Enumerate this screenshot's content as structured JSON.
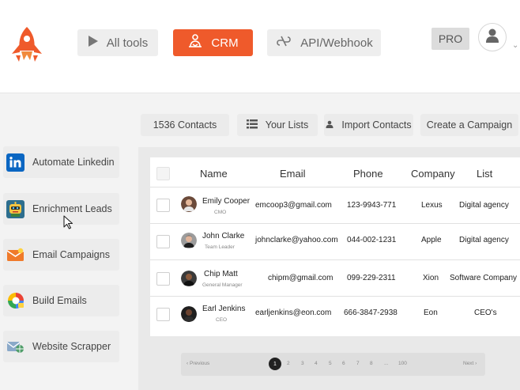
{
  "header": {
    "nav": [
      {
        "label": "All tools",
        "icon": "play-triangle-icon"
      },
      {
        "label": "CRM",
        "icon": "user-lotus-icon"
      },
      {
        "label": "API/Webhook",
        "icon": "webhook-icon"
      }
    ],
    "plan_badge": "PRO",
    "accent_color": "#ef5a2b"
  },
  "toolbar": {
    "contacts_count": "1536 Contacts",
    "your_lists": "Your Lists",
    "import_contacts": "Import Contacts",
    "create_campaign": "Create a Campaign"
  },
  "sidebar": {
    "items": [
      {
        "label": "Automate Linkedin",
        "icon": "linkedin-icon"
      },
      {
        "label": "Enrichment Leads",
        "icon": "robot-icon"
      },
      {
        "label": "Email Campaigns",
        "icon": "envelope-icon"
      },
      {
        "label": "Build Emails",
        "icon": "email-builder-icon"
      },
      {
        "label": "Website Scrapper",
        "icon": "web-mail-icon"
      }
    ]
  },
  "table": {
    "columns": [
      "Name",
      "Email",
      "Phone",
      "Company",
      "List"
    ],
    "rows": [
      {
        "name": "Emily Cooper",
        "title": "CMO",
        "email": "emcoop3@gmail.com",
        "phone": "123-9943-771",
        "company": "Lexus",
        "list": "Digital agency"
      },
      {
        "name": "John Clarke",
        "title": "Team Leader",
        "email": "johnclarke@yahoo.com",
        "phone": "044-002-1231",
        "company": "Apple",
        "list": "Digital agency"
      },
      {
        "name": "Chip Matt",
        "title": "General Manager",
        "email": "chipm@gmail.com",
        "phone": "099-229-2311",
        "company": "Xion",
        "list": "Software Company"
      },
      {
        "name": "Earl Jenkins",
        "title": "CEO",
        "email": "earljenkins@eon.com",
        "phone": "666-3847-2938",
        "company": "Eon",
        "list": "CEO's"
      }
    ]
  },
  "pagination": {
    "previous": "Previous",
    "next": "Next",
    "pages": [
      "1",
      "2",
      "3",
      "4",
      "5",
      "6",
      "7",
      "8",
      "...",
      "100"
    ],
    "current": "1"
  }
}
